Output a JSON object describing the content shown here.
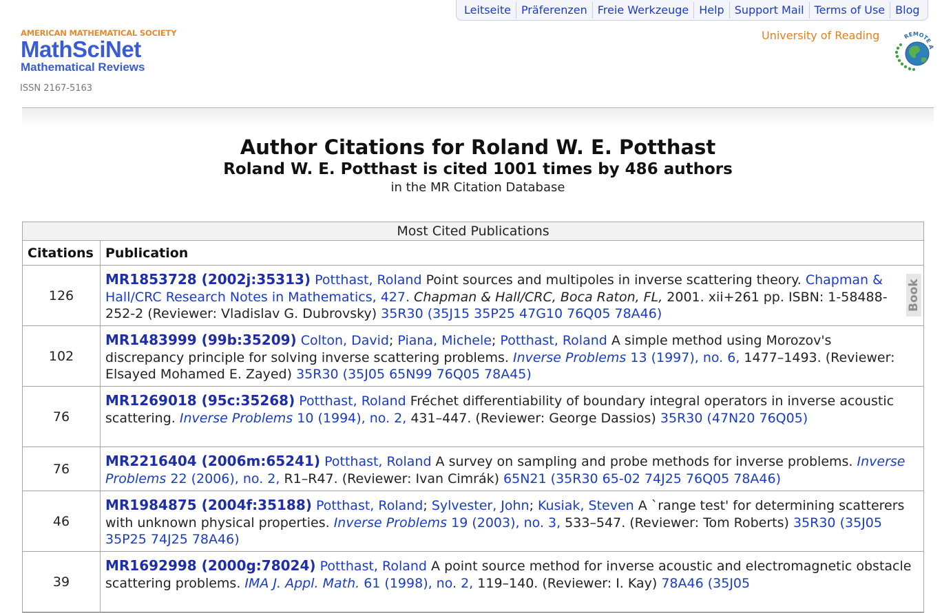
{
  "nav": {
    "items": [
      "Leitseite",
      "Präferenzen",
      "Freie Werkzeuge",
      "Help",
      "Support Mail",
      "Terms of Use",
      "Blog"
    ]
  },
  "header": {
    "ams": "AMERICAN MATHEMATICAL SOCIETY",
    "brand": "MathSciNet",
    "subbrand": "Mathematical Reviews",
    "issn": "ISSN 2167-5163",
    "institution": "University of Reading",
    "badge_text": "REMOTE ACCESS"
  },
  "titles": {
    "main": "Author Citations for Roland W. E. Potthast",
    "sub": "Roland W. E. Potthast is cited 1001 times by 486 authors",
    "note": "in the MR Citation Database"
  },
  "table": {
    "caption": "Most Cited Publications",
    "col_citations": "Citations",
    "col_publication": "Publication",
    "book_tab": "Book",
    "rows": [
      {
        "citations": "126",
        "mr": "MR1853728 (2002j:35313)",
        "authors": [
          "Potthast, Roland"
        ],
        "title": " Point sources and multipoles in inverse scattering theory. ",
        "series": "Chapman & Hall/CRC Research Notes in Mathematics, 427.",
        "publisher": " Chapman & Hall/CRC, Boca Raton, FL,",
        "details": " 2001. xii+261 pp. ISBN: 1-58488-252-2 (Reviewer: Vladislav G. Dubrovsky) ",
        "classes": "35R30 (35J15 35P25 47G10 76Q05 78A46)"
      },
      {
        "citations": "102",
        "mr": "MR1483999 (99b:35209)",
        "authors": [
          "Colton, David",
          "Piana, Michele",
          "Potthast, Roland"
        ],
        "title": " A simple method using Morozov's discrepancy principle for solving inverse scattering problems. ",
        "journal": "Inverse Problems",
        "issue": " 13 (1997), no. 6,",
        "details": " 1477–1493. (Reviewer: Elsayed Mohamed E. Zayed) ",
        "classes": "35R30 (35J05 65N99 76Q05 78A45)"
      },
      {
        "citations": "76",
        "mr": "MR1269018 (95c:35268)",
        "authors": [
          "Potthast, Roland"
        ],
        "title": " Fréchet differentiability of boundary integral operators in inverse acoustic scattering. ",
        "journal": "Inverse Problems",
        "issue": " 10 (1994), no. 2,",
        "details": " 431–447. (Reviewer: George Dassios) ",
        "classes": "35R30 (47N20 76Q05)"
      },
      {
        "citations": "76",
        "mr": "MR2216404 (2006m:65241)",
        "authors": [
          "Potthast, Roland"
        ],
        "title": " A survey on sampling and probe methods for inverse problems. ",
        "journal": "Inverse Problems",
        "issue": " 22 (2006), no. 2,",
        "details": " R1–R47. (Reviewer: Ivan Cimrák) ",
        "classes": "65N21 (35R30 65-02 74J25 76Q05 78A46)"
      },
      {
        "citations": "46",
        "mr": "MR1984875 (2004f:35188)",
        "authors": [
          "Potthast, Roland",
          "Sylvester, John",
          "Kusiak, Steven"
        ],
        "title": " A `range test' for determining scatterers with unknown physical properties. ",
        "journal": "Inverse Problems",
        "issue": " 19 (2003), no. 3,",
        "details": " 533–547. (Reviewer: Tom Roberts) ",
        "classes": "35R30 (35J05 35P25 74J25 78A46)"
      },
      {
        "citations": "39",
        "mr": "MR1692998 (2000g:78024)",
        "authors": [
          "Potthast, Roland"
        ],
        "title": " A point source method for inverse acoustic and electromagnetic obstacle scattering problems. ",
        "journal": "IMA J. Appl. Math.",
        "issue": " 61 (1998), no. 2,",
        "details": " 119–140. (Reviewer: I. Kay) ",
        "classes": "78A46 (35J05"
      }
    ]
  },
  "colors": {
    "link": "#1a3bc9",
    "mr_number": "#1d2ea6",
    "institution": "#e0801f",
    "brand": "#3a5cd1"
  }
}
